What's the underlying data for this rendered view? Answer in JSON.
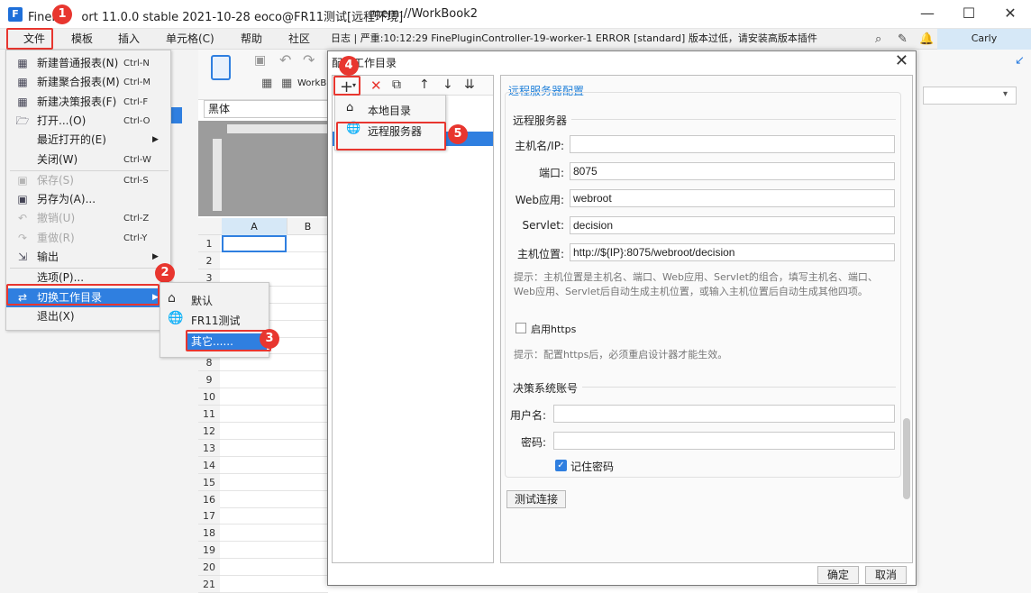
{
  "window": {
    "title": "FineReport 11.0.0 stable 2021-10-28 eoco@FR11测试[远程环境]",
    "title_visible_prefix": "FineR",
    "title_visible_suffix": "ort 11.0.0 stable 2021-10-28 eoco@FR11测试[远程环境]",
    "workbook": "mem://WorkBook2",
    "minimize": "—",
    "maximize": "☐",
    "close": "✕"
  },
  "menubar": {
    "items": [
      "文件",
      "模板",
      "插入",
      "单元格(C)",
      "帮助",
      "社区"
    ],
    "log_text": "日志 | 严重:10:12:29 FinePluginController-19-worker-1 ERROR [standard] 版本过低，请安装高版本插件",
    "user": "Carly"
  },
  "file_menu": {
    "items": [
      {
        "label": "新建普通报表(N)",
        "shortcut": "Ctrl-N",
        "icon": "grid-icon",
        "disabled": false
      },
      {
        "label": "新建聚合报表(M)",
        "shortcut": "Ctrl-M",
        "icon": "grid-icon",
        "disabled": false
      },
      {
        "label": "新建决策报表(F)",
        "shortcut": "Ctrl-F",
        "icon": "grid-icon",
        "disabled": false
      },
      {
        "label": "打开...(O)",
        "shortcut": "Ctrl-O",
        "icon": "folder-icon",
        "disabled": false
      },
      {
        "label": "最近打开的(E)",
        "shortcut": "",
        "icon": "",
        "disabled": false,
        "submenu": true
      },
      {
        "label": "关闭(W)",
        "shortcut": "Ctrl-W",
        "icon": "",
        "disabled": false
      },
      {
        "label": "保存(S)",
        "shortcut": "Ctrl-S",
        "icon": "save-icon",
        "disabled": true
      },
      {
        "label": "另存为(A)...",
        "shortcut": "",
        "icon": "save-as-icon",
        "disabled": false
      },
      {
        "label": "撤销(U)",
        "shortcut": "Ctrl-Z",
        "icon": "undo-icon",
        "disabled": true
      },
      {
        "label": "重做(R)",
        "shortcut": "Ctrl-Y",
        "icon": "redo-icon",
        "disabled": true
      },
      {
        "label": "输出",
        "shortcut": "",
        "icon": "export-icon",
        "disabled": false,
        "submenu": true
      },
      {
        "label": "选项(P)...",
        "shortcut": "",
        "icon": "",
        "disabled": false
      },
      {
        "label": "切换工作目录",
        "shortcut": "",
        "icon": "switch-icon",
        "disabled": false,
        "submenu": true,
        "selected": true
      },
      {
        "label": "退出(X)",
        "shortcut": "",
        "icon": "",
        "disabled": false
      }
    ]
  },
  "switch_submenu": {
    "items": [
      "默认",
      "FR11测试",
      "其它......"
    ]
  },
  "sheet": {
    "font": "黑体",
    "col_a": "A",
    "col_b": "B",
    "tab": "WorkB",
    "rows": [
      "1",
      "2",
      "3",
      "4",
      "5",
      "6",
      "7",
      "8",
      "9",
      "10",
      "11",
      "12",
      "13",
      "14",
      "15",
      "16",
      "17",
      "18",
      "19",
      "20",
      "21"
    ]
  },
  "dialog": {
    "title_visible": "配置工作目录",
    "add_popup": [
      "本地目录",
      "远程服务器"
    ],
    "tree_item": "远程服务器",
    "panel_title": "远程服务器配置",
    "section1": "远程服务器",
    "fields": {
      "host_label": "主机名/IP:",
      "host_value": "",
      "port_label": "端口:",
      "port_value": "8075",
      "web_label": "Web应用:",
      "web_value": "webroot",
      "servlet_label": "Servlet:",
      "servlet_value": "decision",
      "location_label": "主机位置:",
      "location_value": "http://${IP}:8075/webroot/decision"
    },
    "hint1": "提示：主机位置是主机名、端口、Web应用、Servlet的组合，填写主机名、端口、Web应用、Servlet后自动生成主机位置，或输入主机位置后自动生成其他四项。",
    "https_label": "启用https",
    "hint2": "提示：配置https后，必须重启设计器才能生效。",
    "section2": "决策系统账号",
    "username_label": "用户名:",
    "username_value": "",
    "password_label": "密码:",
    "password_value": "",
    "remember_label": "记住密码",
    "test_button": "测试连接",
    "ok_button": "确定",
    "cancel_button": "取消"
  },
  "badges": [
    "1",
    "2",
    "3",
    "4",
    "5"
  ],
  "colors": {
    "accent": "#1e7fd9",
    "highlight": "#2f7fe0",
    "badge": "#e8362f"
  }
}
